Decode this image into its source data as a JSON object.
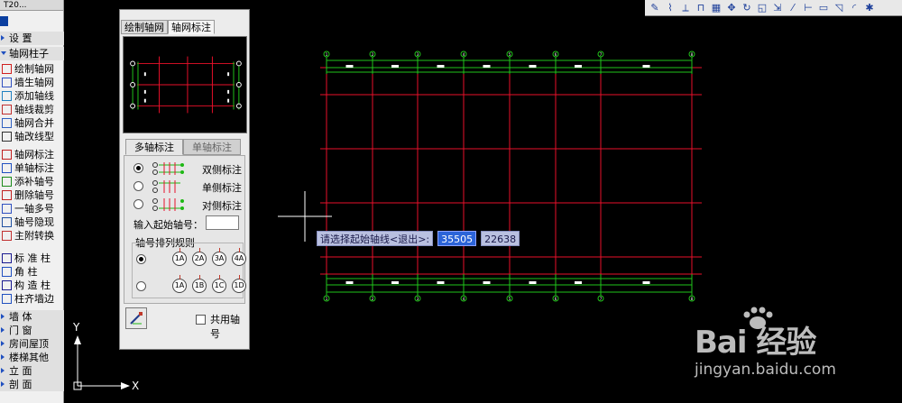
{
  "left_menu": {
    "title": "T20...",
    "items": [
      {
        "label": "设  置",
        "type": "section_top"
      },
      {
        "label": "轴网柱子",
        "type": "section"
      },
      {
        "label": "绘制轴网"
      },
      {
        "label": "墙生轴网"
      },
      {
        "label": "添加轴线"
      },
      {
        "label": "轴线裁剪"
      },
      {
        "label": "轴网合并"
      },
      {
        "label": "轴改线型"
      },
      {
        "label": "轴网标注"
      },
      {
        "label": "单轴标注"
      },
      {
        "label": "添补轴号"
      },
      {
        "label": "删除轴号"
      },
      {
        "label": "一轴多号"
      },
      {
        "label": "轴号隐现"
      },
      {
        "label": "主附转换"
      },
      {
        "label": "标 准 柱"
      },
      {
        "label": "角    柱"
      },
      {
        "label": "构 造 柱"
      },
      {
        "label": "柱齐墙边"
      },
      {
        "label": "墙    体",
        "type": "section"
      },
      {
        "label": "门    窗",
        "type": "section"
      },
      {
        "label": "房间屋顶",
        "type": "section"
      },
      {
        "label": "楼梯其他",
        "type": "section"
      },
      {
        "label": "立    面",
        "type": "section"
      },
      {
        "label": "剖    面",
        "type": "section"
      }
    ]
  },
  "dialog": {
    "tabs": [
      "绘制轴网",
      "轴网标注"
    ],
    "active_tab": 1,
    "subtabs": [
      "多轴标注",
      "单轴标注"
    ],
    "active_subtab": 0,
    "options": [
      "双侧标注",
      "单侧标注",
      "对侧标注"
    ],
    "selected_option": 0,
    "start_label": "输入起始轴号：",
    "start_value": "",
    "rule_title": "轴号排列规则",
    "rule_row1": [
      "1A",
      "2A",
      "3A",
      "4A"
    ],
    "rule_row2": [
      "1A",
      "1B",
      "1C",
      "1D"
    ],
    "selected_rule": 0,
    "shared_axis_label": "共用轴号",
    "shared_axis_checked": false
  },
  "cad": {
    "prompt": "请选择起始轴线<退出>:",
    "coord_x": "35505",
    "coord_y": "22638",
    "axis_labels": [
      "1",
      "2",
      "3",
      "4",
      "5",
      "6",
      "7",
      "8"
    ],
    "ucs_x": "X",
    "ucs_y": "Y",
    "colors": {
      "axis": "#e8102a",
      "dim": "#21c41a",
      "bg": "#000000"
    }
  },
  "watermark": {
    "brand": "Bai 经验",
    "url": "jingyan.baidu.com"
  }
}
